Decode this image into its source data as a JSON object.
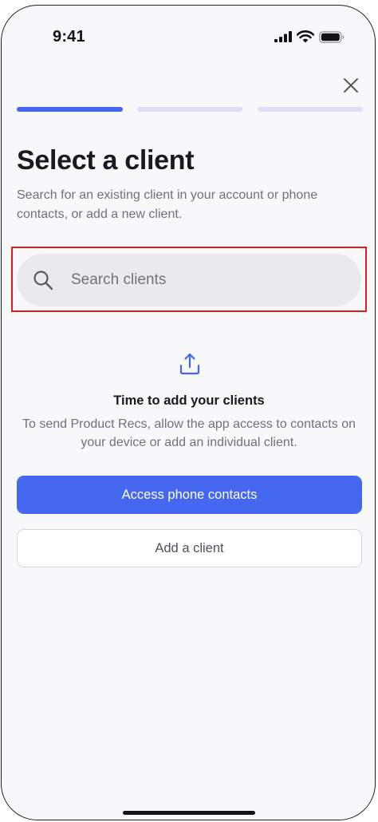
{
  "status_bar": {
    "time": "9:41",
    "icons": [
      "cellular-signal-icon",
      "wifi-icon",
      "battery-icon"
    ]
  },
  "header": {
    "close_icon": "close-icon",
    "progress": {
      "steps_total": 3,
      "current_step": 1
    }
  },
  "main": {
    "title": "Select a client",
    "subtitle": "Search for an existing client in your account or phone contacts, or add a new client.",
    "search": {
      "placeholder": "Search clients",
      "value": "",
      "icon": "search-icon"
    },
    "empty_state": {
      "icon": "upload-icon",
      "title": "Time to add your clients",
      "text": "To send Product Recs, allow the app access to contacts on your device or add an individual client."
    },
    "primary_button_label": "Access phone contacts",
    "secondary_button_label": "Add a client"
  },
  "colors": {
    "accent": "#4567f0",
    "progress_inactive": "#dcdff5",
    "background": "#f7f8fa",
    "highlight": "#e31b1b"
  }
}
